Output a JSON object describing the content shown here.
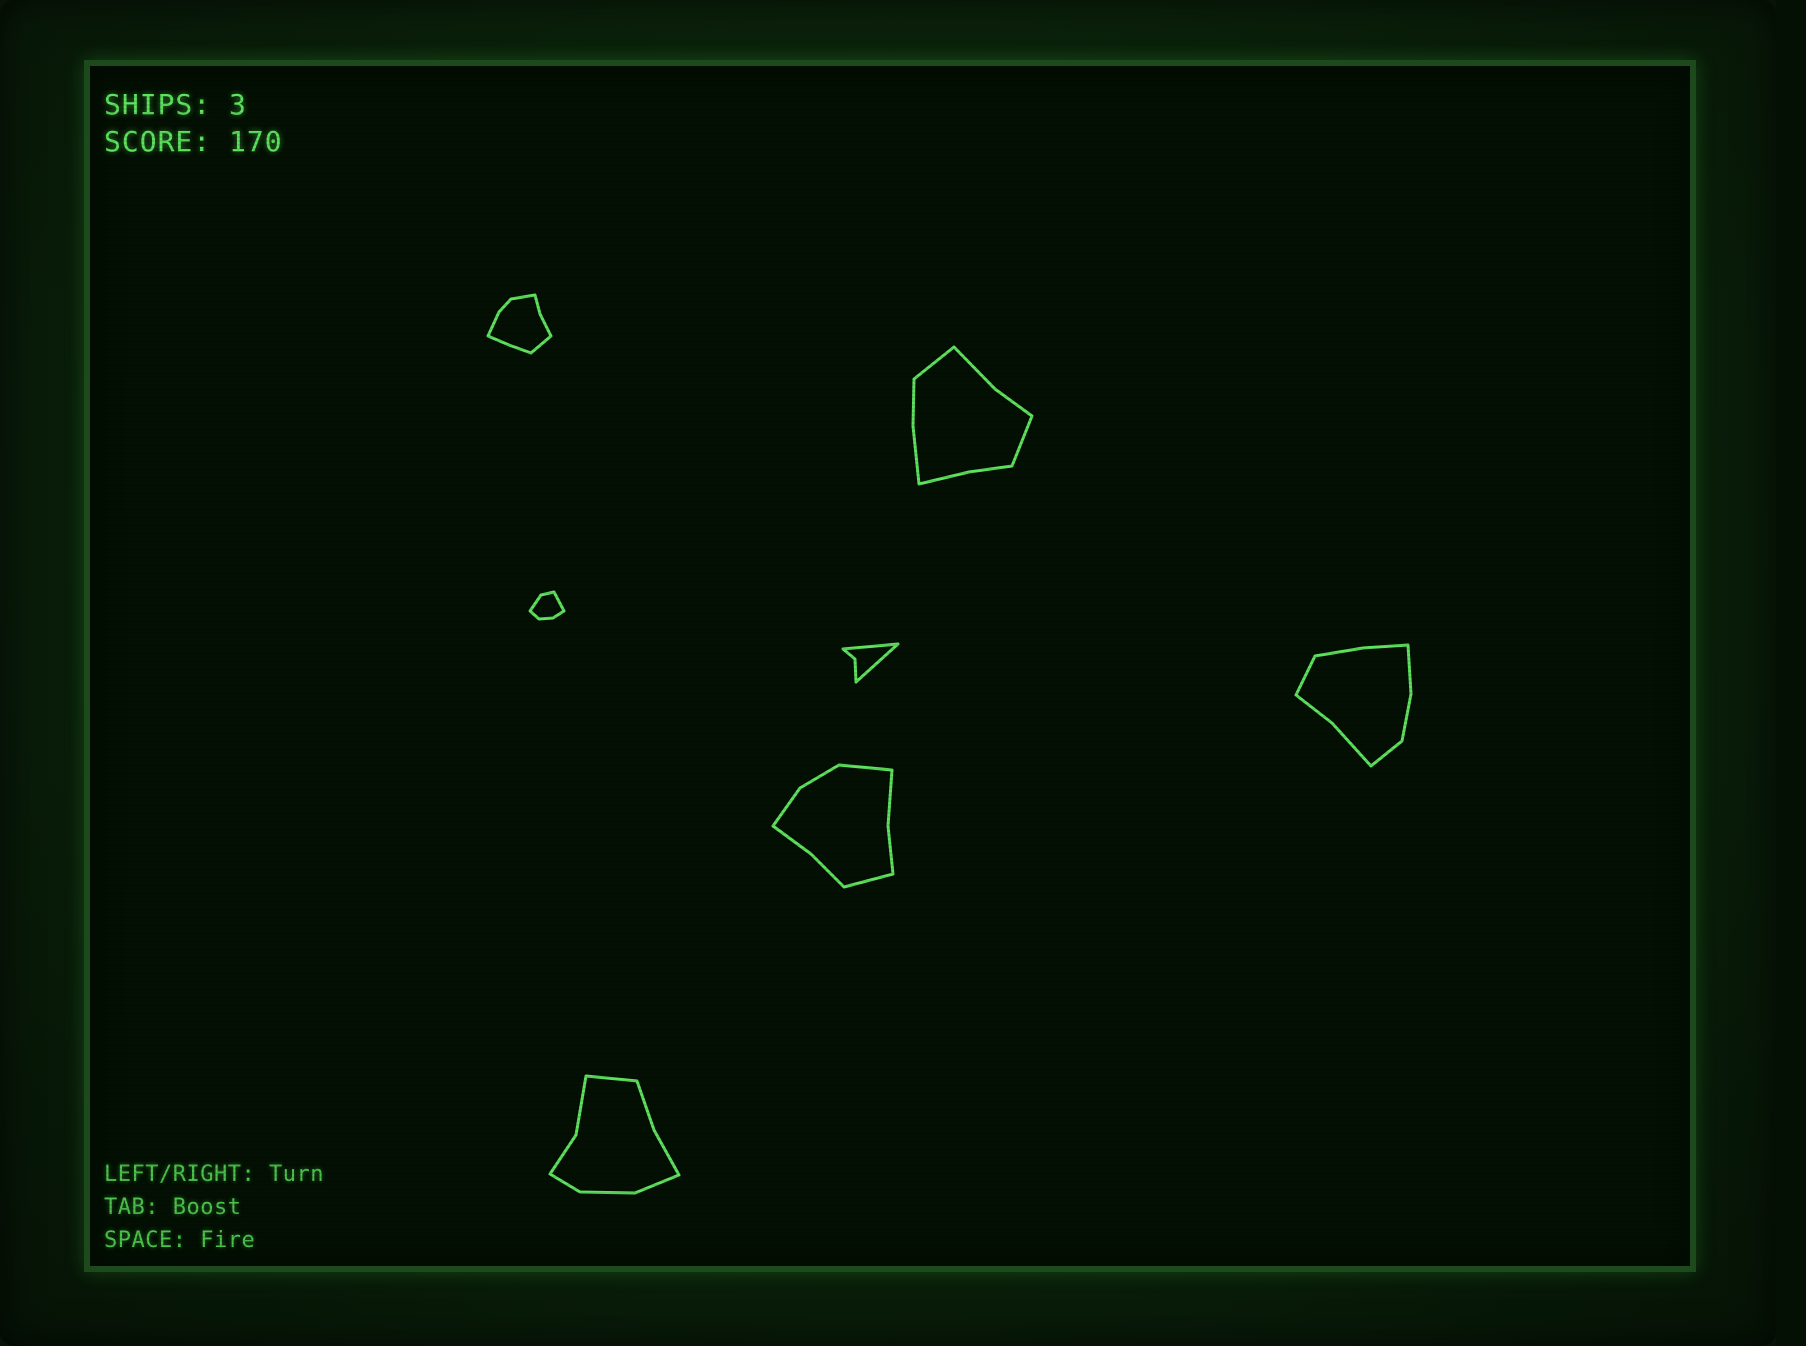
{
  "hud": {
    "ships_label": "SHIPS:",
    "ships_value": "3",
    "score_label": "SCORE:",
    "score_value": "170"
  },
  "controls": {
    "turn_key": "LEFT/RIGHT:",
    "turn_action": "Turn",
    "boost_key": "TAB:",
    "boost_action": "Boost",
    "fire_key": "SPACE:",
    "fire_action": "Fire"
  },
  "colors": {
    "vector": "#5fe35f",
    "screen_bg": "#031003",
    "frame": "#1d4a1d"
  },
  "entities": {
    "ship": "player-ship",
    "asteroids": [
      "asteroid-small",
      "asteroid-large",
      "asteroid-tiny",
      "asteroid-large",
      "asteroid-large",
      "asteroid-large"
    ]
  }
}
